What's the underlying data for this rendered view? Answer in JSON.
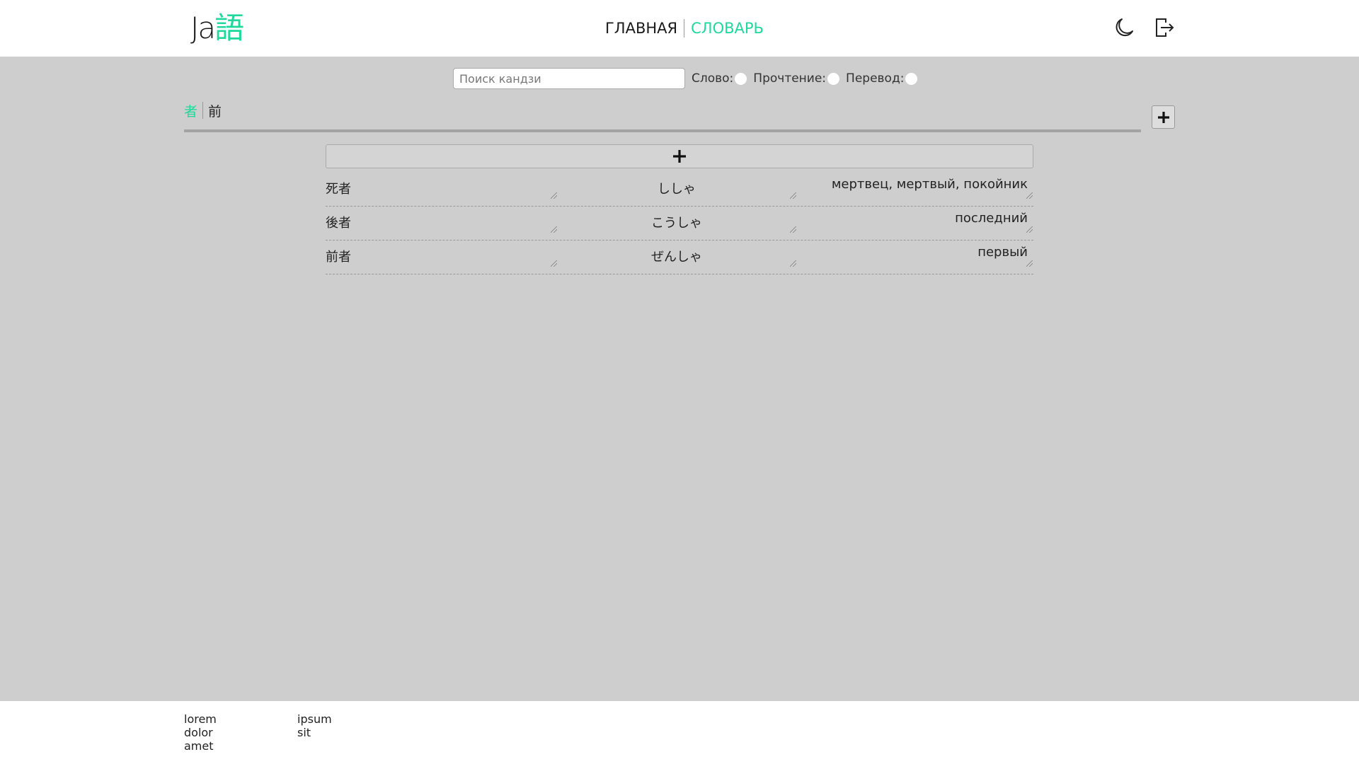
{
  "header": {
    "logo_ja": "Ja",
    "logo_kanji": "語",
    "nav": {
      "main_label": "ГЛАВНАЯ",
      "dictionary_label": "СЛОВАРЬ"
    },
    "icons": [
      "moon-icon",
      "logout-icon"
    ]
  },
  "search": {
    "placeholder": "Поиск кандзи",
    "value": "",
    "filters": [
      {
        "label": "Слово:",
        "checked": false
      },
      {
        "label": "Прочтение:",
        "checked": false
      },
      {
        "label": "Перевод:",
        "checked": false
      }
    ]
  },
  "kanji_tabs": [
    {
      "label": "者",
      "active": true
    },
    {
      "label": "前",
      "active": false
    }
  ],
  "words": [
    {
      "word": "死者",
      "reading": "ししゃ",
      "translation": "мертвец, мертвый, покойник"
    },
    {
      "word": "後者",
      "reading": "こうしゃ",
      "translation": "последний"
    },
    {
      "word": "前者",
      "reading": "ぜんしゃ",
      "translation": "первый"
    }
  ],
  "footer": {
    "col1": [
      "lorem",
      "dolor",
      "amet"
    ],
    "col2": [
      "ipsum",
      "sit"
    ]
  },
  "colors": {
    "accent": "#1fd89a",
    "background": "#cecece"
  }
}
